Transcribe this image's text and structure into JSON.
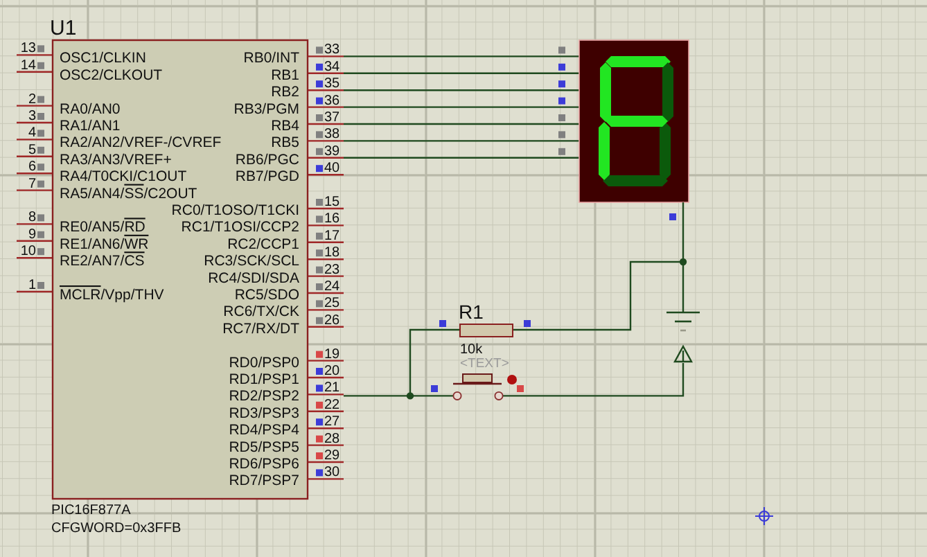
{
  "microcontroller": {
    "designator": "U1",
    "part": "PIC16F877A",
    "property": "CFGWORD=0x3FFB",
    "left_pin_groups": [
      [
        {
          "number": "13",
          "color": "#808080",
          "label": [
            {
              "text": "OSC1/CLKIN",
              "overline": false
            }
          ]
        },
        {
          "number": "14",
          "color": "#808080",
          "label": [
            {
              "text": "OSC2/CLKOUT",
              "overline": false
            }
          ]
        }
      ],
      [
        {
          "number": "2",
          "color": "#808080",
          "label": [
            {
              "text": "RA0/AN0",
              "overline": false
            }
          ]
        },
        {
          "number": "3",
          "color": "#808080",
          "label": [
            {
              "text": "RA1/AN1",
              "overline": false
            }
          ]
        },
        {
          "number": "4",
          "color": "#808080",
          "label": [
            {
              "text": "RA2/AN2/VREF-/CVREF",
              "overline": false
            }
          ]
        },
        {
          "number": "5",
          "color": "#808080",
          "label": [
            {
              "text": "RA3/AN3/VREF+",
              "overline": false
            }
          ]
        },
        {
          "number": "6",
          "color": "#808080",
          "label": [
            {
              "text": "RA4/T0CKI/C1OUT",
              "overline": false
            }
          ]
        },
        {
          "number": "7",
          "color": "#808080",
          "label": [
            {
              "text": "RA5/AN4/",
              "overline": false
            },
            {
              "text": "SS",
              "overline": true
            },
            {
              "text": "/C2OUT",
              "overline": false
            }
          ]
        }
      ],
      [
        {
          "number": "8",
          "color": "#808080",
          "label": [
            {
              "text": "RE0/AN5/",
              "overline": false
            },
            {
              "text": "RD",
              "overline": true
            }
          ]
        },
        {
          "number": "9",
          "color": "#808080",
          "label": [
            {
              "text": "RE1/AN6/",
              "overline": false
            },
            {
              "text": "WR",
              "overline": true
            }
          ]
        },
        {
          "number": "10",
          "color": "#808080",
          "label": [
            {
              "text": "RE2/AN7/",
              "overline": false
            },
            {
              "text": "CS",
              "overline": true
            }
          ]
        }
      ],
      [
        {
          "number": "1",
          "color": "#808080",
          "label": [
            {
              "text": "MCLR",
              "overline": true
            },
            {
              "text": "/Vpp/THV",
              "overline": false
            }
          ]
        }
      ]
    ],
    "right_pin_groups": [
      [
        {
          "number": "33",
          "color": "#808080",
          "label": "RB0/INT"
        },
        {
          "number": "34",
          "color": "#3c3cd8",
          "label": "RB1"
        },
        {
          "number": "35",
          "color": "#3c3cd8",
          "label": "RB2"
        },
        {
          "number": "36",
          "color": "#3c3cd8",
          "label": "RB3/PGM"
        },
        {
          "number": "37",
          "color": "#808080",
          "label": "RB4"
        },
        {
          "number": "38",
          "color": "#808080",
          "label": "RB5"
        },
        {
          "number": "39",
          "color": "#808080",
          "label": "RB6/PGC"
        },
        {
          "number": "40",
          "color": "#3c3cd8",
          "label": "RB7/PGD"
        }
      ],
      [
        {
          "number": "15",
          "color": "#808080",
          "label": "RC0/T1OSO/T1CKI"
        },
        {
          "number": "16",
          "color": "#808080",
          "label": "RC1/T1OSI/CCP2"
        },
        {
          "number": "17",
          "color": "#808080",
          "label": "RC2/CCP1"
        },
        {
          "number": "18",
          "color": "#808080",
          "label": "RC3/SCK/SCL"
        },
        {
          "number": "23",
          "color": "#808080",
          "label": "RC4/SDI/SDA"
        },
        {
          "number": "24",
          "color": "#808080",
          "label": "RC5/SDO"
        },
        {
          "number": "25",
          "color": "#808080",
          "label": "RC6/TX/CK"
        },
        {
          "number": "26",
          "color": "#808080",
          "label": "RC7/RX/DT"
        }
      ],
      [
        {
          "number": "19",
          "color": "#d84848",
          "label": "RD0/PSP0"
        },
        {
          "number": "20",
          "color": "#3c3cd8",
          "label": "RD1/PSP1"
        },
        {
          "number": "21",
          "color": "#3c3cd8",
          "label": "RD2/PSP2"
        },
        {
          "number": "22",
          "color": "#d84848",
          "label": "RD3/PSP3"
        },
        {
          "number": "27",
          "color": "#3c3cd8",
          "label": "RD4/PSP4"
        },
        {
          "number": "28",
          "color": "#d84848",
          "label": "RD5/PSP5"
        },
        {
          "number": "29",
          "color": "#d84848",
          "label": "RD6/PSP6"
        },
        {
          "number": "30",
          "color": "#3c3cd8",
          "label": "RD7/PSP7"
        }
      ]
    ]
  },
  "seven_segment_display": {
    "segments": [
      {
        "on": true
      },
      {
        "on": false
      },
      {
        "on": false
      },
      {
        "on": false
      },
      {
        "on": true
      },
      {
        "on": true
      },
      {
        "on": true
      }
    ],
    "pins": [
      {
        "color": "#808080"
      },
      {
        "color": "#3c3cd8"
      },
      {
        "color": "#3c3cd8"
      },
      {
        "color": "#3c3cd8"
      },
      {
        "color": "#808080"
      },
      {
        "color": "#808080"
      },
      {
        "color": "#808080"
      }
    ],
    "common_pin": {
      "color": "#3c3cd8"
    }
  },
  "resistor": {
    "designator": "R1",
    "value": "10k",
    "text": "<TEXT>",
    "pins": [
      {
        "color": "#3c3cd8"
      },
      {
        "color": "#3c3cd8"
      }
    ]
  },
  "push_button": {
    "pins": [
      {
        "color": "#3c3cd8"
      },
      {
        "color": "#d84848"
      }
    ]
  }
}
